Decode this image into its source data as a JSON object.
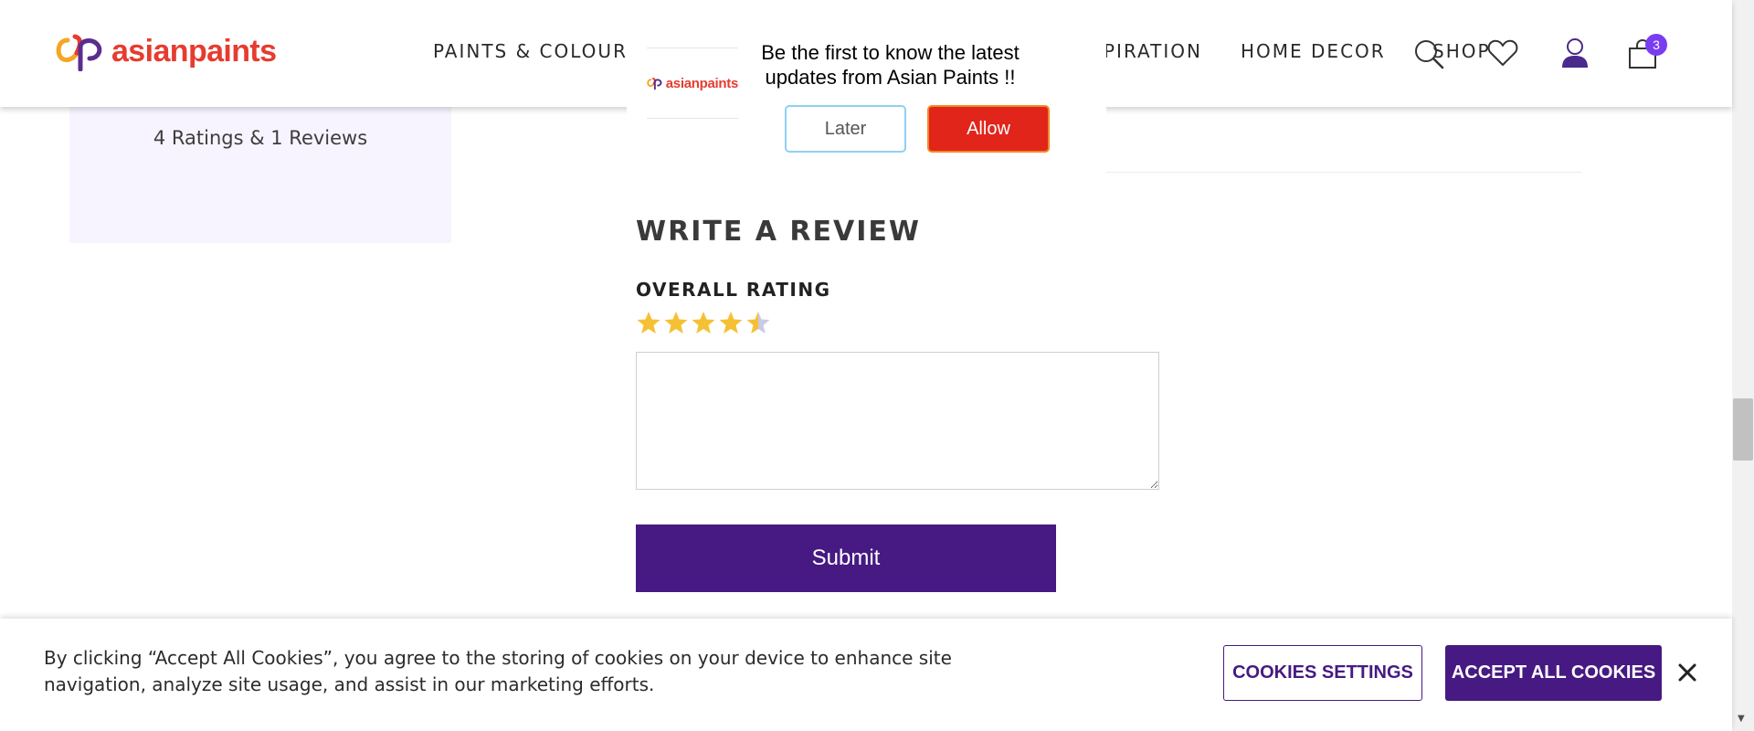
{
  "brand": {
    "name": "asianpaints",
    "logo_colors": [
      "#e63c2f",
      "#f5a623",
      "#5b2d8e"
    ]
  },
  "header": {
    "nav": [
      {
        "label": "PAINTS & COLOUR"
      },
      {
        "label": "PIRATION"
      },
      {
        "label": "HOME DECOR"
      },
      {
        "label": "SHOP"
      }
    ],
    "icons": [
      "search-icon",
      "wishlist-heart-icon",
      "user-account-icon",
      "shopping-bag-icon"
    ],
    "cart_count": "3"
  },
  "notification_prompt": {
    "message": "Be the first to know the latest updates from Asian Paints !!",
    "later_label": "Later",
    "allow_label": "Allow"
  },
  "ratings": {
    "summary": "4 Ratings & 1 Reviews"
  },
  "review_form": {
    "title": "WRITE A REVIEW",
    "overall_rating_label": "OVERALL RATING",
    "rating_value": 4.5,
    "rating_max": 5,
    "textarea_value": "",
    "submit_label": "Submit"
  },
  "cookie_banner": {
    "text": "By clicking “Accept All Cookies”, you agree to the storing of cookies on your device to enhance site navigation, analyze site usage, and assist in our marketing efforts.",
    "settings_label": "COOKIES SETTINGS",
    "accept_label": "ACCEPT ALL COOKIES"
  },
  "colors": {
    "primary_purple": "#461a82",
    "star_gold": "#f5c033",
    "star_empty": "#c9c9e8",
    "allow_red": "#e1251b",
    "panel_bg": "#f7f4ff"
  }
}
